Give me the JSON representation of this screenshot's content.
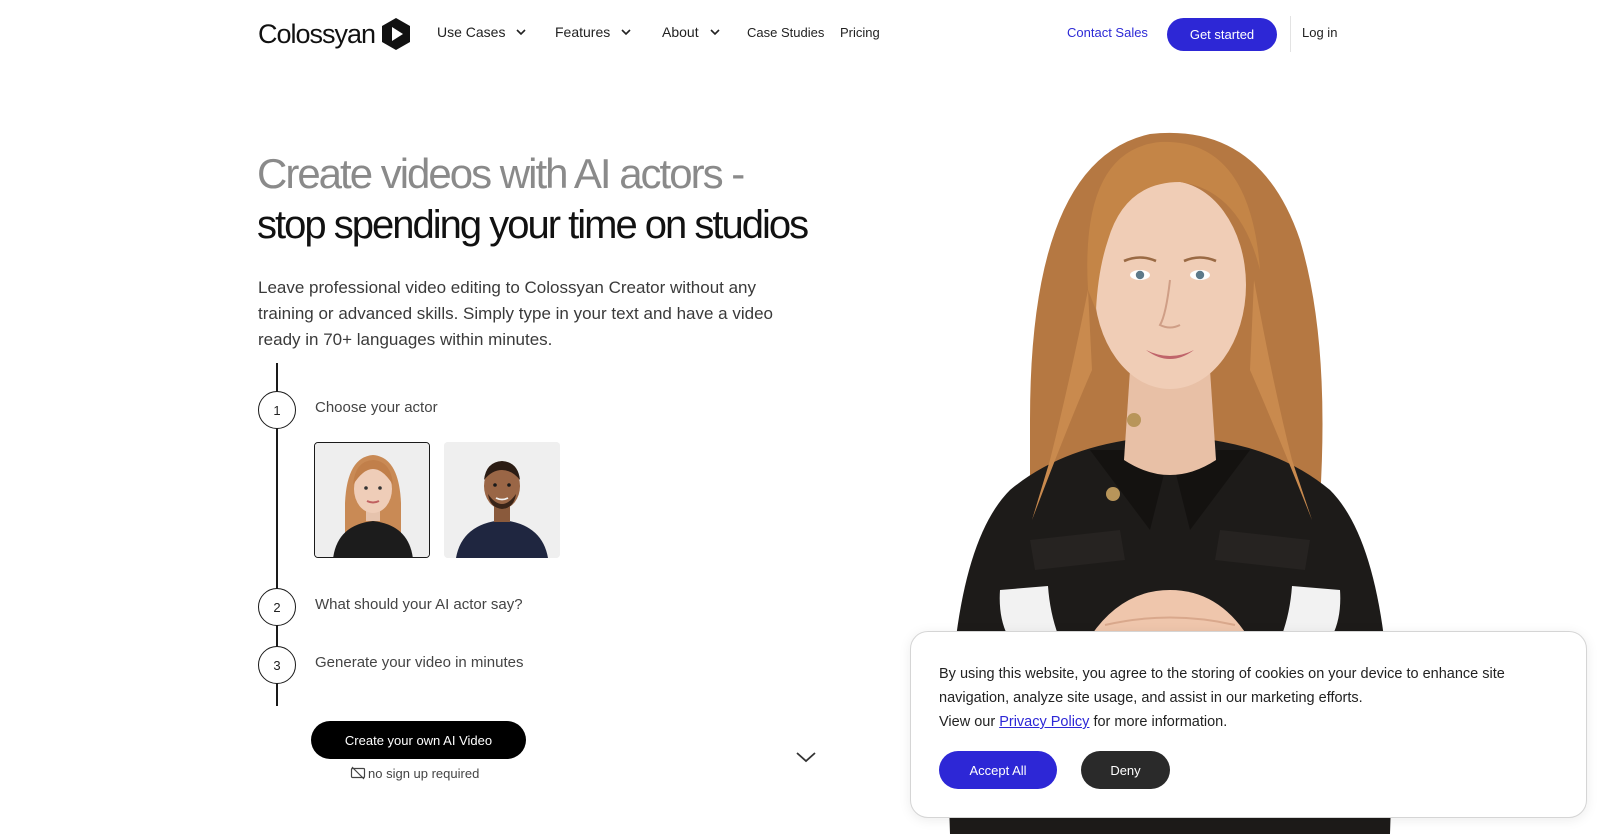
{
  "brand": {
    "name": "Colossyan",
    "accent": "#2d27d6"
  },
  "nav": {
    "items": [
      {
        "label": "Use Cases",
        "icon": "chevron-down-icon"
      },
      {
        "label": "Features",
        "icon": "chevron-down-icon"
      },
      {
        "label": "About",
        "icon": "chevron-down-icon"
      }
    ],
    "links": [
      "Case Studies",
      "Pricing"
    ],
    "contact_sales": "Contact Sales",
    "get_started": "Get started",
    "login": "Log in"
  },
  "hero": {
    "headline_1": "Create videos with AI actors -",
    "headline_2": "stop spending your time on studios",
    "lead": "Leave professional video editing to Colossyan Creator without any training or advanced skills. Simply type in your text and have a video ready in 70+ languages within minutes.",
    "steps": [
      {
        "num": "1",
        "label": "Choose your actor"
      },
      {
        "num": "2",
        "label": "What should your AI actor say?"
      },
      {
        "num": "3",
        "label": "Generate your video in minutes"
      }
    ],
    "actors": [
      "actor-woman-red-hair",
      "actor-man-navy-shirt"
    ],
    "cta": "Create your own AI Video",
    "no_signup": "no sign up required"
  },
  "cookie": {
    "text": "By using this website, you agree to the storing of cookies on your device to enhance site navigation, analyze site usage, and assist in our marketing efforts.",
    "view_prefix": "View our",
    "privacy_link": "Privacy Policy",
    "view_suffix": "for more information.",
    "accept": "Accept All",
    "deny": "Deny"
  }
}
